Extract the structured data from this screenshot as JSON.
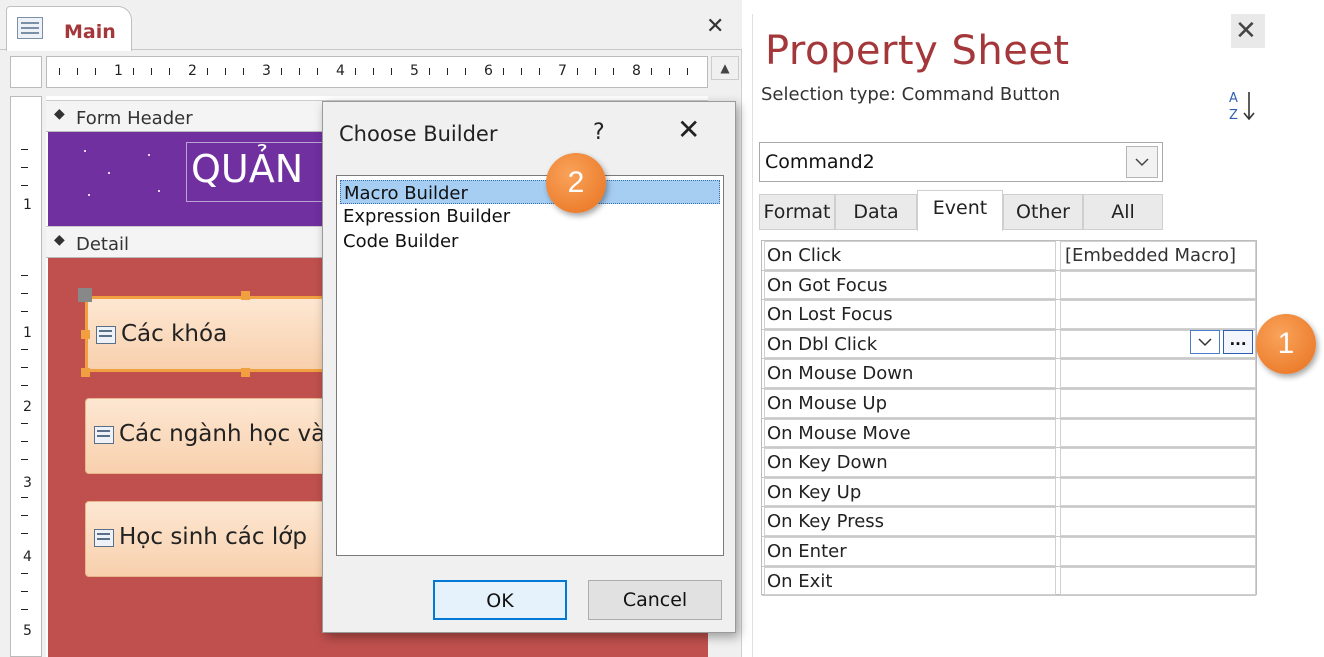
{
  "document_tab": {
    "label": "Main",
    "close": "✕"
  },
  "ruler": {
    "h_numbers": [
      "1",
      "2",
      "3",
      "4",
      "5",
      "6",
      "7",
      "8"
    ],
    "v_numbers": [
      "1",
      "1",
      "2",
      "3",
      "4",
      "5"
    ]
  },
  "form": {
    "header_section": "Form Header",
    "detail_section": "Detail",
    "title_text": "QUẢN",
    "buttons": [
      "Các khóa",
      "Các ngành học và",
      "Học sinh các lớp"
    ],
    "colors": {
      "header": "#7030a0",
      "detail": "#c0504d",
      "button": "#fbdcc0",
      "selection": "#f0a040"
    }
  },
  "dialog": {
    "title": "Choose Builder",
    "help": "?",
    "close": "✕",
    "options": [
      "Macro Builder",
      "Expression Builder",
      "Code Builder"
    ],
    "selected_option": "Macro Builder",
    "ok_label": "OK",
    "cancel_label": "Cancel"
  },
  "property_sheet": {
    "title": "Property Sheet",
    "close": "✕",
    "selection_type": "Selection type:  Command Button",
    "object_name": "Command2",
    "tabs": [
      "Format",
      "Data",
      "Event",
      "Other",
      "All"
    ],
    "active_tab": "Event",
    "properties": [
      {
        "name": "On Click",
        "value": "[Embedded Macro]"
      },
      {
        "name": "On Got Focus",
        "value": ""
      },
      {
        "name": "On Lost Focus",
        "value": ""
      },
      {
        "name": "On Dbl Click",
        "value": ""
      },
      {
        "name": "On Mouse Down",
        "value": ""
      },
      {
        "name": "On Mouse Up",
        "value": ""
      },
      {
        "name": "On Mouse Move",
        "value": ""
      },
      {
        "name": "On Key Down",
        "value": ""
      },
      {
        "name": "On Key Up",
        "value": ""
      },
      {
        "name": "On Key Press",
        "value": ""
      },
      {
        "name": "On Enter",
        "value": ""
      },
      {
        "name": "On Exit",
        "value": ""
      }
    ],
    "builder_button": "...",
    "title_color": "#a4373a"
  },
  "badges": {
    "step1": "1",
    "step2": "2",
    "color": "#ed7d31"
  }
}
